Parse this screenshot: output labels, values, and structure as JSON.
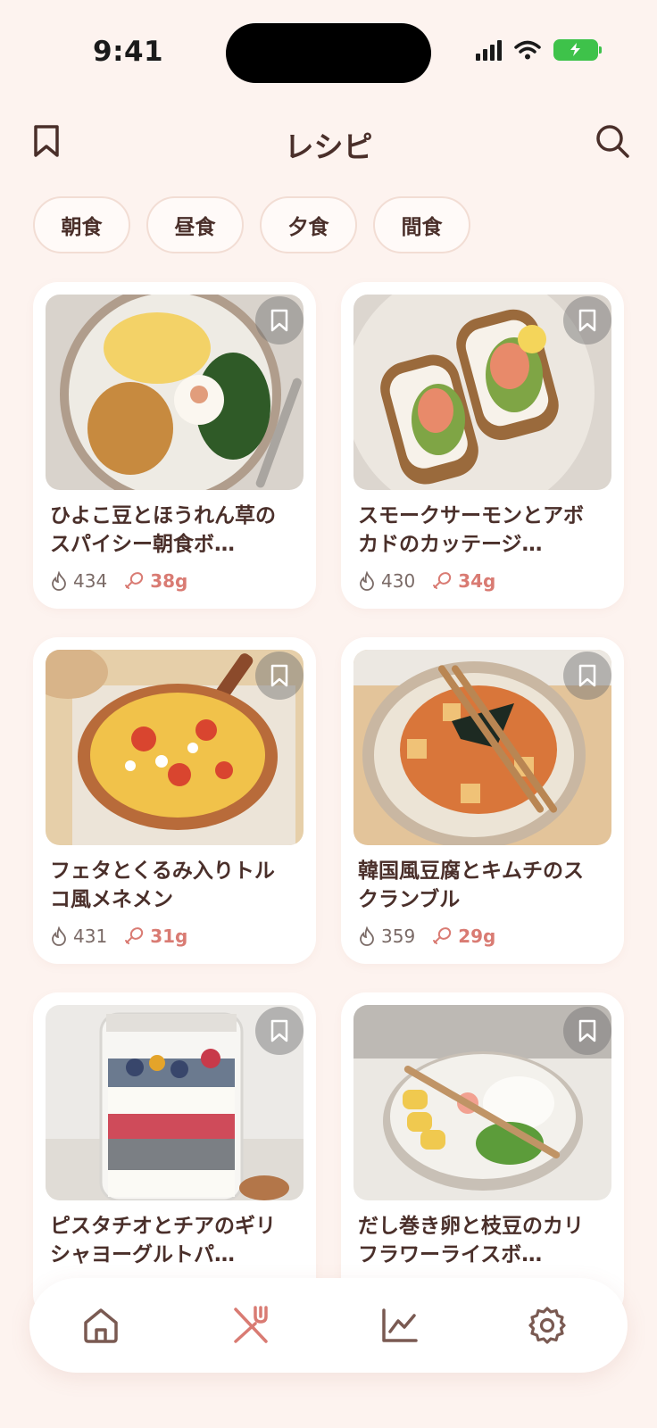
{
  "status": {
    "time": "9:41"
  },
  "header": {
    "title": "レシピ",
    "bookmark_icon": "bookmark-icon",
    "search_icon": "search-icon"
  },
  "chips": [
    {
      "label": "朝食"
    },
    {
      "label": "昼食"
    },
    {
      "label": "夕食"
    },
    {
      "label": "間食"
    }
  ],
  "recipes": [
    {
      "title": "ひよこ豆とほうれん草のスパイシー朝食ボ…",
      "kcal": "434",
      "protein": "38g",
      "image": "chickpea-spinach-bowl-photo"
    },
    {
      "title": "スモークサーモンとアボカドのカッテージ…",
      "kcal": "430",
      "protein": "34g",
      "image": "salmon-avocado-toast-photo"
    },
    {
      "title": "フェタとくるみ入りトルコ風メネメン",
      "kcal": "431",
      "protein": "31g",
      "image": "menemen-pan-photo"
    },
    {
      "title": "韓国風豆腐とキムチのスクランブル",
      "kcal": "359",
      "protein": "29g",
      "image": "tofu-kimchi-scramble-photo"
    },
    {
      "title": "ピスタチオとチアのギリシャヨーグルトパ…",
      "kcal": "",
      "protein": "",
      "image": "yogurt-parfait-jar-photo"
    },
    {
      "title": "だし巻き卵と枝豆のカリフラワーライスボ…",
      "kcal": "",
      "protein": "",
      "image": "tamagoyaki-cauliflower-bowl-photo"
    }
  ],
  "tabbar": {
    "items": [
      {
        "name": "home",
        "icon": "home-icon"
      },
      {
        "name": "recipes",
        "icon": "utensils-icon",
        "active": true
      },
      {
        "name": "stats",
        "icon": "chart-icon"
      },
      {
        "name": "settings",
        "icon": "gear-icon"
      }
    ]
  },
  "colors": {
    "background": "#fdf3ef",
    "accent": "#d97b73",
    "text": "#4a2f2a",
    "chip_border": "#f2ddd4"
  }
}
